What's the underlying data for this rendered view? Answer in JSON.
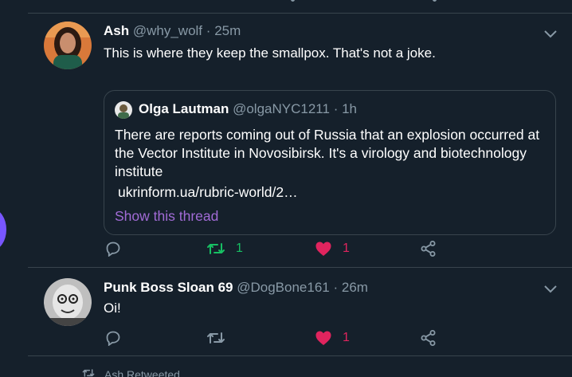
{
  "tweets": [
    {
      "name": "Ash",
      "handle": "@why_wolf",
      "time": "25m",
      "text": "This is where they keep the smallpox. That's not a joke.",
      "quote": {
        "name": "Olga Lautman",
        "handle": "@olgaNYC1211",
        "time": "1h",
        "text": "There are reports coming out of Russia that an explosion occurred at the Vector Institute in Novosibirsk. It's a virology and biotechnology institute",
        "link": "ukrinform.ua/rubric-world/2…",
        "thread_label": "Show this thread"
      },
      "actions": {
        "retweets": "1",
        "likes": "1",
        "retweeted": true,
        "liked": true
      }
    },
    {
      "name": "Punk Boss Sloan 69",
      "handle": "@DogBone161",
      "time": "26m",
      "text": "Oi!",
      "actions": {
        "retweets": "",
        "likes": "1",
        "retweeted": false,
        "liked": true
      }
    }
  ],
  "separator": "·",
  "retweeted_note": "Ash Retweeted",
  "colors": {
    "background": "#15202b",
    "border": "#38444d",
    "muted": "#8899a6",
    "retweet": "#17bf63",
    "like": "#e0245e",
    "link": "#a16bd6"
  },
  "icons": [
    "reply-icon",
    "retweet-icon",
    "heart-icon",
    "share-icon",
    "chevron-down-icon"
  ]
}
